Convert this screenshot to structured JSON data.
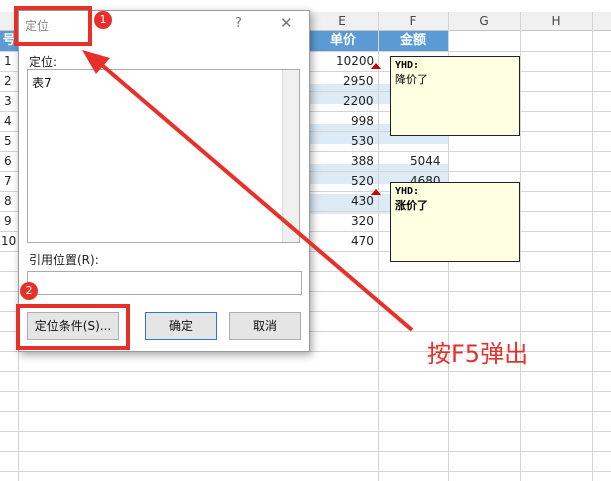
{
  "sheet": {
    "columns": [
      "E",
      "F",
      "G",
      "H"
    ],
    "partial_row_header": "号",
    "row_numbers": [
      "1",
      "2",
      "3",
      "4",
      "5",
      "6",
      "7",
      "8",
      "9",
      "10"
    ],
    "header_cells": {
      "E": "单价",
      "F": "金额"
    },
    "e_values": [
      "10200",
      "2950",
      "2200",
      "998",
      "530",
      "388",
      "520",
      "430",
      "320",
      "470"
    ],
    "f_values": [
      "",
      "",
      "",
      "",
      "",
      "5044",
      "4680",
      "",
      "",
      ""
    ]
  },
  "comments": [
    {
      "author": "YHD:",
      "text": "降价了",
      "bold": false
    },
    {
      "author": "YHD:",
      "text": "涨价了",
      "bold": true
    }
  ],
  "dialog": {
    "title": "定位",
    "help": "?",
    "close": "✕",
    "goto_label": "定位:",
    "list_items": [
      "表7"
    ],
    "reference_label": "引用位置(R):",
    "reference_value": "",
    "special_button": "定位条件(S)...",
    "ok_button": "确定",
    "cancel_button": "取消"
  },
  "annotations": {
    "badge1": "1",
    "badge2": "2",
    "callout": "按F5弹出",
    "accent_color": "#e8302b"
  }
}
